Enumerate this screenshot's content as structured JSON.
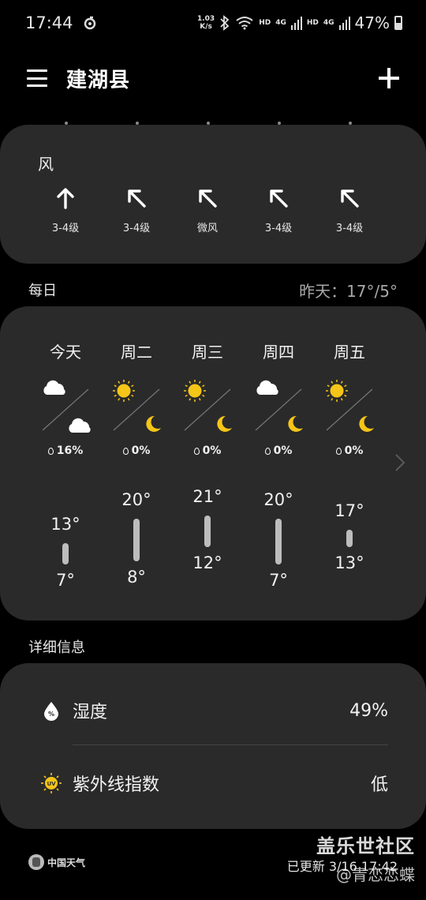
{
  "status_bar": {
    "time": "17:44",
    "net_speed_value": "1.03",
    "net_speed_unit": "K/s",
    "sim1": "HD",
    "sim1_net": "4G",
    "sim2": "HD",
    "sim2_net": "4G",
    "battery": "47%"
  },
  "app_bar": {
    "city": "建湖县"
  },
  "wind": {
    "label": "风",
    "items": [
      {
        "direction": "north",
        "level": "3-4级"
      },
      {
        "direction": "northwest",
        "level": "3-4级"
      },
      {
        "direction": "northwest",
        "level": "微风"
      },
      {
        "direction": "northwest",
        "level": "3-4级"
      },
      {
        "direction": "northwest",
        "level": "3-4级"
      }
    ]
  },
  "daily": {
    "title": "每日",
    "yesterday": "昨天：17°/5°",
    "days": [
      {
        "name": "今天",
        "day_icon": "cloud-icon",
        "night_icon": "cloud-icon",
        "precip": "16%",
        "high": "13°",
        "low": "7°"
      },
      {
        "name": "周二",
        "day_icon": "sun-icon",
        "night_icon": "moon-icon",
        "precip": "0%",
        "high": "20°",
        "low": "8°"
      },
      {
        "name": "周三",
        "day_icon": "sun-icon",
        "night_icon": "moon-icon",
        "precip": "0%",
        "high": "21°",
        "low": "12°"
      },
      {
        "name": "周四",
        "day_icon": "cloud-icon",
        "night_icon": "moon-icon",
        "precip": "0%",
        "high": "20°",
        "low": "7°"
      },
      {
        "name": "周五",
        "day_icon": "sun-icon",
        "night_icon": "moon-icon",
        "precip": "0%",
        "high": "17°",
        "low": "13°"
      }
    ]
  },
  "details": {
    "title": "详细信息",
    "humidity_label": "湿度",
    "humidity_value": "49%",
    "uv_label": "紫外线指数",
    "uv_value": "低"
  },
  "footer": {
    "logo_text": "中国天气",
    "updated": "已更新 3/16 17:42"
  },
  "watermark": {
    "line1": "盖乐世社区",
    "line2": "@青恋恋蝶"
  },
  "colors": {
    "background": "#000000",
    "card": "#2a2a2a",
    "sun": "#f5c518",
    "moon": "#f5c518",
    "cloud": "#ffffff",
    "temp_bar": "#bdbdbd"
  }
}
